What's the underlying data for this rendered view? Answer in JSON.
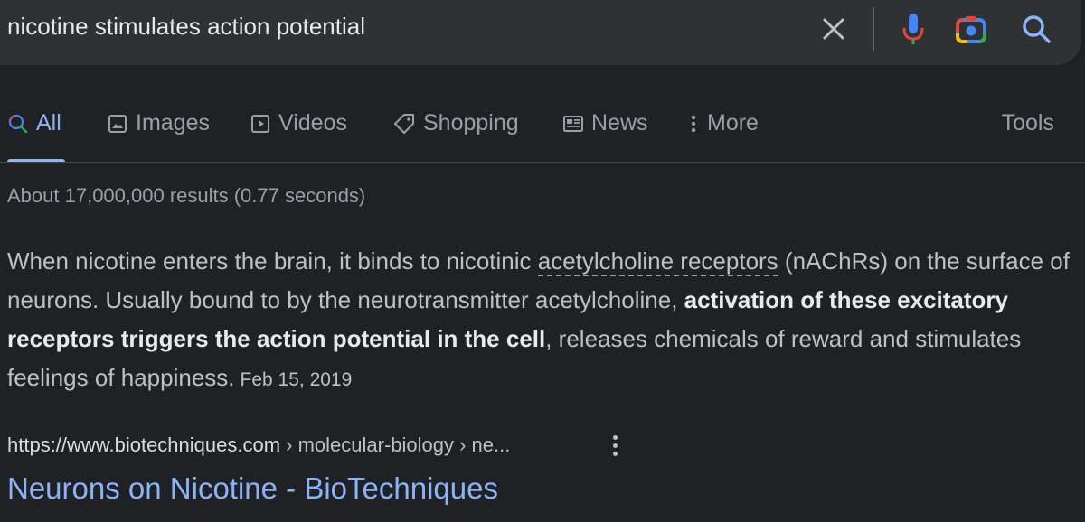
{
  "search": {
    "query": "nicotine stimulates action potential",
    "icons": [
      "close-icon",
      "mic-icon",
      "camera-icon",
      "search-icon"
    ]
  },
  "tabs": [
    {
      "label": "All",
      "icon": "search-icon",
      "active": true
    },
    {
      "label": "Images",
      "icon": "image-icon"
    },
    {
      "label": "Videos",
      "icon": "play-icon"
    },
    {
      "label": "Shopping",
      "icon": "tag-icon"
    },
    {
      "label": "News",
      "icon": "newspaper-icon"
    },
    {
      "label": "More",
      "icon": "more-vert-icon"
    }
  ],
  "tools_label": "Tools",
  "stats": "About 17,000,000 results (0.77 seconds)",
  "snippet": {
    "part1": "When nicotine enters the brain, it binds to nicotinic ",
    "link_term": "acetylcholine receptors",
    "part2": " (nAChRs) on the surface of neurons. Usually bound to by the neurotransmitter acetylcholine, ",
    "bold": "activation of these excitatory receptors triggers the action potential in the cell",
    "part3": ", releases chemicals of reward and stimulates feelings of happiness.",
    "date": "Feb 15, 2019"
  },
  "result": {
    "url_base": "https://www.biotechniques.com",
    "url_path": " › molecular-biology › ne...",
    "title": "Neurons on Nicotine - BioTechniques"
  },
  "colors": {
    "background": "#202124",
    "searchbar": "#303134",
    "link": "#8ab4f8",
    "text": "#bdc1c6"
  }
}
